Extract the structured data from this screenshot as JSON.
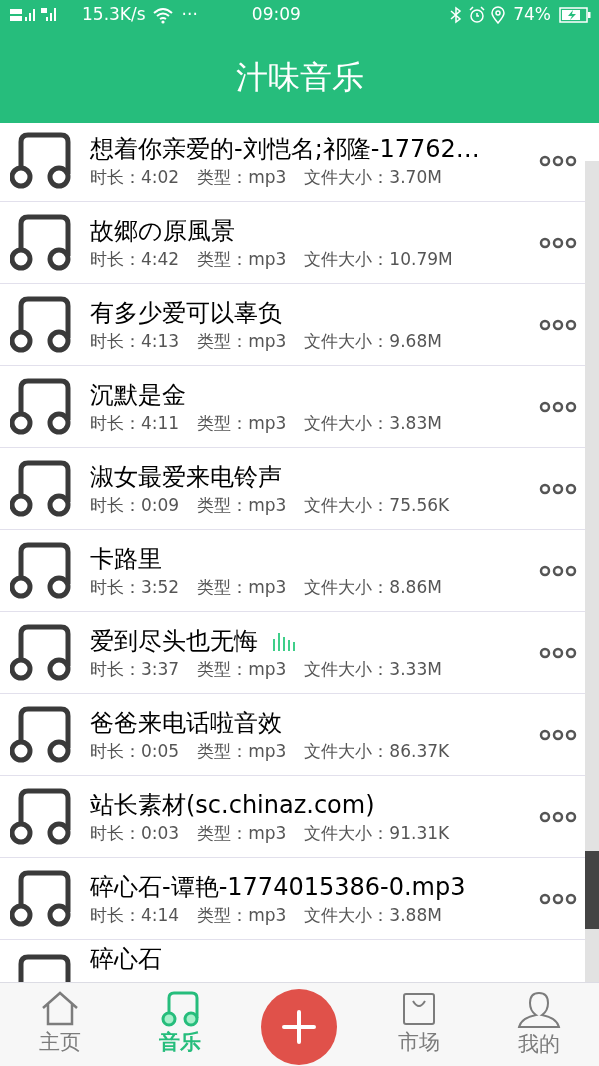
{
  "status_bar": {
    "network": "15.3K/s",
    "more": "···",
    "time": "09:09",
    "battery": "74%"
  },
  "header": {
    "title": "汁味音乐"
  },
  "songs": [
    {
      "title": "想着你亲爱的-刘恺名;祁隆-17762…",
      "duration": "时长：4:02",
      "type": "类型：mp3",
      "size": "文件大小：3.70M",
      "playing": false
    },
    {
      "title": "故郷の原風景",
      "duration": "时长：4:42",
      "type": "类型：mp3",
      "size": "文件大小：10.79M",
      "playing": false
    },
    {
      "title": "有多少爱可以辜负",
      "duration": "时长：4:13",
      "type": "类型：mp3",
      "size": "文件大小：9.68M",
      "playing": false
    },
    {
      "title": "沉默是金",
      "duration": "时长：4:11",
      "type": "类型：mp3",
      "size": "文件大小：3.83M",
      "playing": false
    },
    {
      "title": "淑女最爱来电铃声",
      "duration": "时长：0:09",
      "type": "类型：mp3",
      "size": "文件大小：75.56K",
      "playing": false
    },
    {
      "title": "卡路里",
      "duration": "时长：3:52",
      "type": "类型：mp3",
      "size": "文件大小：8.86M",
      "playing": false
    },
    {
      "title": "爱到尽头也无悔",
      "duration": "时长：3:37",
      "type": "类型：mp3",
      "size": "文件大小：3.33M",
      "playing": true
    },
    {
      "title": "爸爸来电话啦音效",
      "duration": "时长：0:05",
      "type": "类型：mp3",
      "size": "文件大小：86.37K",
      "playing": false
    },
    {
      "title": "站长素材(sc.chinaz.com)",
      "duration": "时长：0:03",
      "type": "类型：mp3",
      "size": "文件大小：91.31K",
      "playing": false
    },
    {
      "title": "碎心石-谭艳-1774015386-0.mp3",
      "duration": "时长：4:14",
      "type": "类型：mp3",
      "size": "文件大小：3.88M",
      "playing": false
    },
    {
      "title": "碎心石"
    }
  ],
  "bottom_nav": [
    {
      "kind": "home",
      "label": "主页",
      "selected": false
    },
    {
      "kind": "music",
      "label": "音乐",
      "selected": true
    },
    {
      "kind": "add"
    },
    {
      "kind": "shop",
      "label": "市场",
      "selected": false
    },
    {
      "kind": "profile",
      "label": "我的",
      "selected": false
    }
  ]
}
